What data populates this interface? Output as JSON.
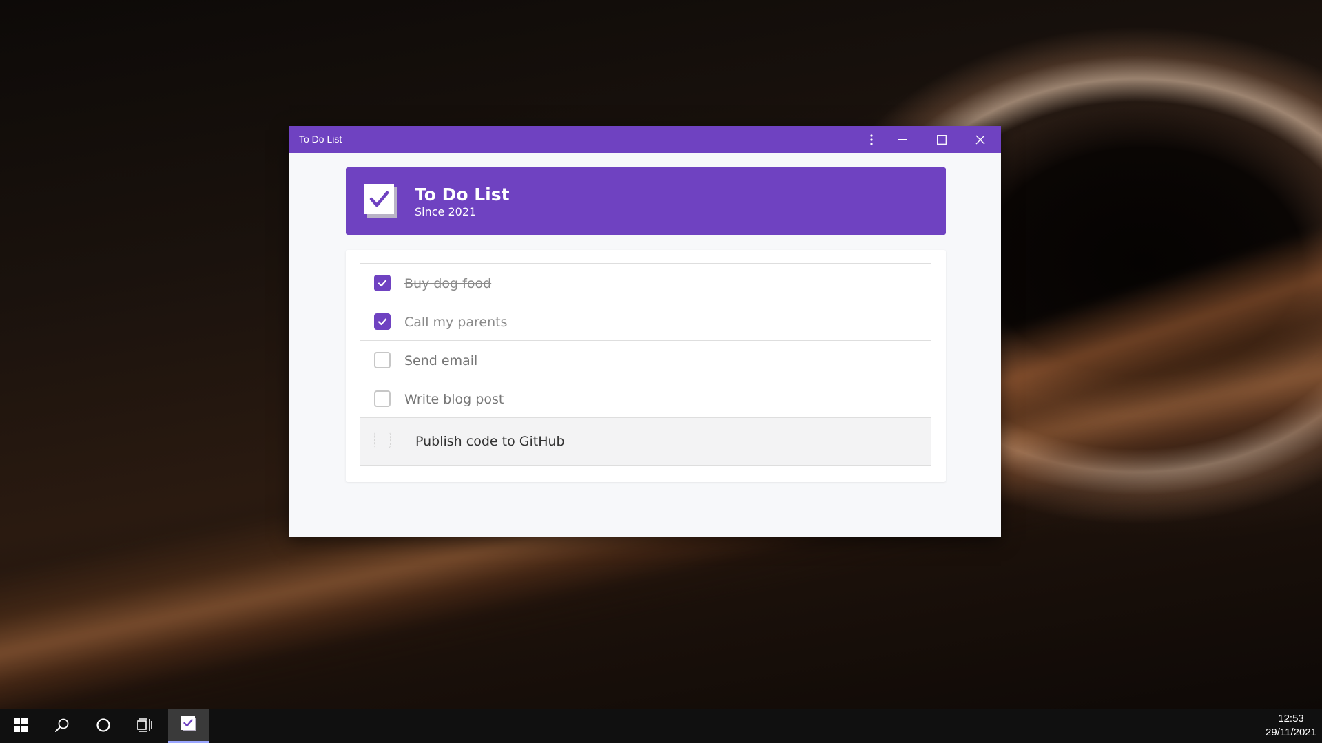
{
  "window": {
    "title": "To Do List"
  },
  "header": {
    "title": "To Do List",
    "subtitle": "Since 2021"
  },
  "todos": [
    {
      "text": "Buy dog food",
      "done": true
    },
    {
      "text": "Call my parents",
      "done": true
    },
    {
      "text": "Send email",
      "done": false
    },
    {
      "text": "Write blog post",
      "done": false
    }
  ],
  "new_item": {
    "text": "Publish code to GitHub"
  },
  "taskbar": {
    "time": "12:53",
    "date": "29/11/2021"
  },
  "colors": {
    "accent": "#6f42c1",
    "window_bg": "#f7f8fa"
  },
  "icons": {
    "menu": "more-vertical-icon",
    "minimize": "minimize-icon",
    "maximize": "maximize-icon",
    "close": "close-icon",
    "app": "checkbox-check-icon",
    "start": "windows-start-icon",
    "search": "search-icon",
    "cortana": "cortana-icon",
    "task_view": "task-view-icon"
  }
}
